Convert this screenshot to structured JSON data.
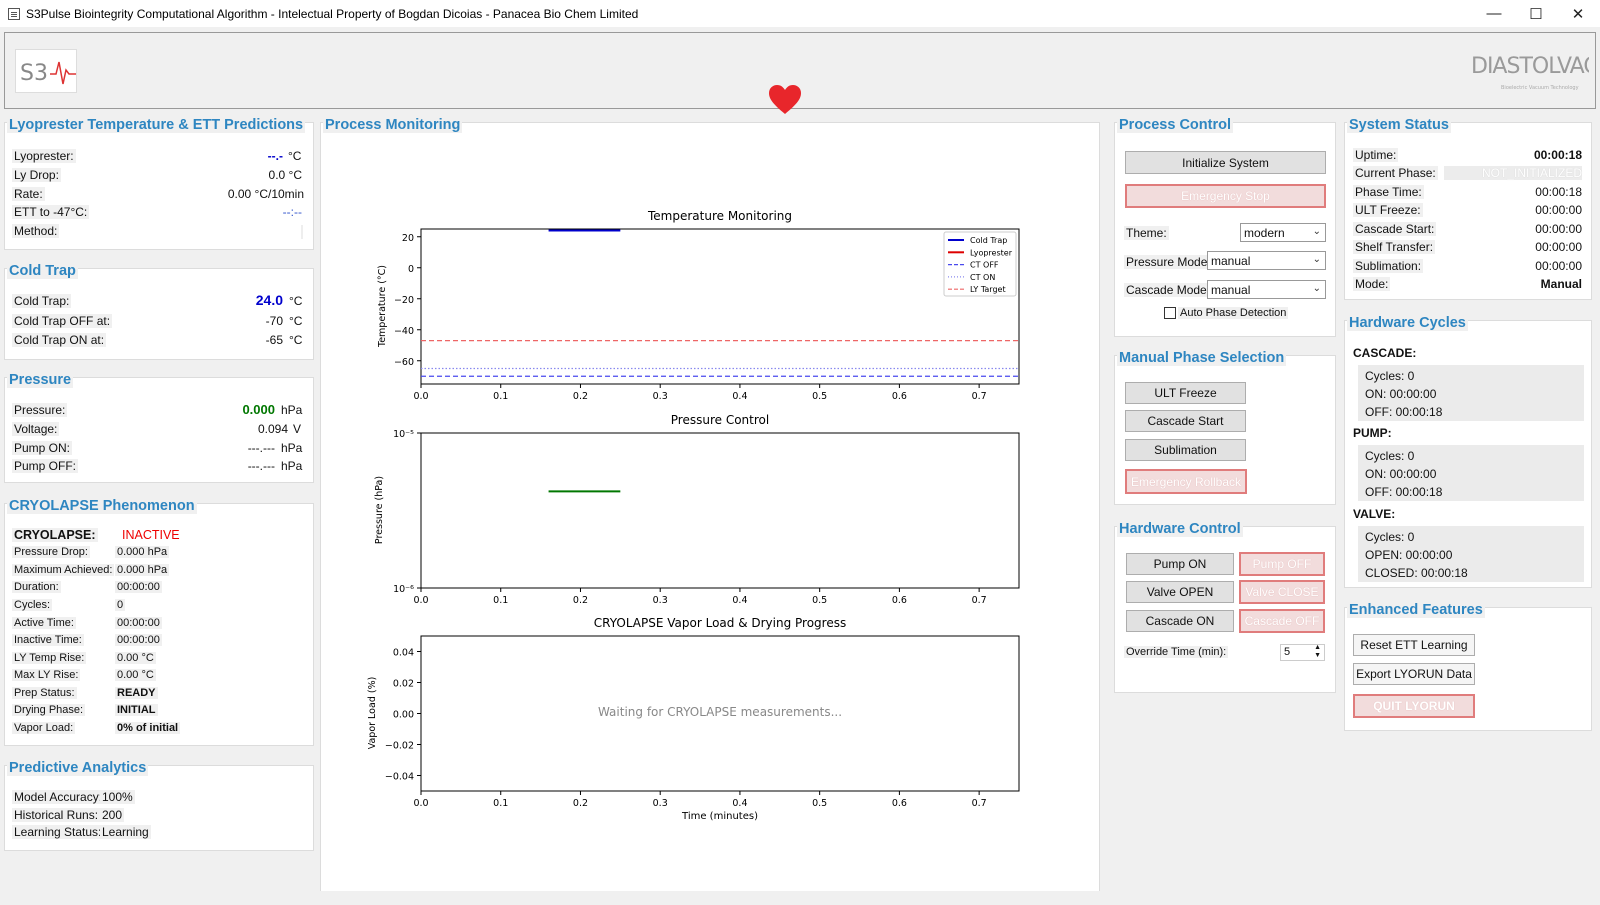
{
  "window": {
    "title": "S3Pulse Biointegrity Computational Algorithm - Intelectual Property of Bogdan Dicoias - Panacea Bio Chem Limited",
    "min": "—",
    "max": "☐",
    "close": "✕"
  },
  "branding": {
    "left_logo": "S3",
    "right_logo": "DIASTOLVAC",
    "right_logo_tag": "Bioelectric Vacuum Technology"
  },
  "lyo": {
    "title": "Lyoprester Temperature & ETT Predictions",
    "rows": [
      {
        "label": "Lyoprester:",
        "value": "--.-",
        "unit": "°C"
      },
      {
        "label": "Ly Drop:",
        "value": "0.0 °C",
        "unit": ""
      },
      {
        "label": "Rate:",
        "value": "0.00 °C/10min",
        "unit": ""
      },
      {
        "label": "ETT to -47°C:",
        "value": "--:--",
        "unit": ""
      },
      {
        "label": "Method:",
        "value": "",
        "unit": ""
      }
    ]
  },
  "cold": {
    "title": "Cold Trap",
    "rows": [
      {
        "label": "Cold Trap:",
        "value": "24.0",
        "unit": "°C"
      },
      {
        "label": "Cold Trap OFF at:",
        "value": "-70",
        "unit": "°C"
      },
      {
        "label": "Cold Trap ON at:",
        "value": "-65",
        "unit": "°C"
      }
    ]
  },
  "pressure": {
    "title": "Pressure",
    "rows": [
      {
        "label": "Pressure:",
        "value": "0.000",
        "unit": "hPa"
      },
      {
        "label": "Voltage:",
        "value": "0.094",
        "unit": "V"
      },
      {
        "label": "Pump ON:",
        "value": "---.---",
        "unit": "hPa"
      },
      {
        "label": "Pump OFF:",
        "value": "---.---",
        "unit": "hPa"
      }
    ]
  },
  "cryo": {
    "title": "CRYOLAPSE Phenomenon",
    "rows": [
      {
        "label": "CRYOLAPSE:",
        "value": "INACTIVE"
      },
      {
        "label": "Pressure Drop:",
        "value": "0.000  hPa"
      },
      {
        "label": "Maximum Achieved:",
        "value": "0.000  hPa"
      },
      {
        "label": "Duration:",
        "value": "00:00:00"
      },
      {
        "label": "Cycles:",
        "value": "0"
      },
      {
        "label": "Active Time:",
        "value": "00:00:00"
      },
      {
        "label": "Inactive Time:",
        "value": "00:00:00"
      },
      {
        "label": "LY Temp Rise:",
        "value": "0.00  °C"
      },
      {
        "label": "Max LY Rise:",
        "value": "0.00  °C"
      },
      {
        "label": "Prep Status:",
        "value": "READY"
      },
      {
        "label": "Drying Phase:",
        "value": "INITIAL"
      },
      {
        "label": "Vapor Load:",
        "value": "0% of initial"
      }
    ]
  },
  "pred": {
    "title": "Predictive Analytics",
    "rows": [
      {
        "label": "Model Accuracy:",
        "value": "100%"
      },
      {
        "label": "Historical Runs:",
        "value": "200"
      },
      {
        "label": "Learning Status:",
        "value": "Learning"
      }
    ]
  },
  "monitor": {
    "title": "Process Monitoring"
  },
  "chart_data": [
    {
      "type": "line",
      "title": "Temperature Monitoring",
      "xlabel": "",
      "ylabel": "Temperature (°C)",
      "xlim": [
        0,
        0.75
      ],
      "ylim": [
        -75,
        25
      ],
      "xticks": [
        "0.0",
        "0.1",
        "0.2",
        "0.3",
        "0.4",
        "0.5",
        "0.6",
        "0.7"
      ],
      "yticks": [
        "20",
        "0",
        "−20",
        "−40",
        "−60"
      ],
      "ytick_values": [
        20,
        0,
        -20,
        -40,
        -60
      ],
      "legend": "top-right",
      "series": [
        {
          "name": "Cold Trap",
          "color": "#0000cc",
          "style": "solid",
          "x": [
            0.16,
            0.25
          ],
          "y": [
            24,
            24
          ]
        },
        {
          "name": "Lyoprester",
          "color": "#dd0000",
          "style": "solid",
          "x": [],
          "y": []
        },
        {
          "name": "CT OFF",
          "color": "#4a4aee",
          "style": "dashed",
          "x": [
            0,
            0.75
          ],
          "y": [
            -70,
            -70
          ]
        },
        {
          "name": "CT ON",
          "color": "#8888ee",
          "style": "dotted",
          "x": [
            0,
            0.75
          ],
          "y": [
            -65,
            -65
          ]
        },
        {
          "name": "LY Target",
          "color": "#ee6666",
          "style": "dashed",
          "x": [
            0,
            0.75
          ],
          "y": [
            -47,
            -47
          ]
        }
      ]
    },
    {
      "type": "line",
      "title": "Pressure Control",
      "xlabel": "",
      "ylabel": "Pressure (hPa)",
      "xlim": [
        0,
        0.75
      ],
      "ylim": [
        1e-06,
        1e-05
      ],
      "yscale": "log",
      "xticks": [
        "0.0",
        "0.1",
        "0.2",
        "0.3",
        "0.4",
        "0.5",
        "0.6",
        "0.7"
      ],
      "yticks": [
        "10⁻⁵",
        "10⁻⁶"
      ],
      "series": [
        {
          "name": "",
          "color": "#007700",
          "style": "solid",
          "x": [
            0.16,
            0.25
          ],
          "y": [
            4.2e-06,
            4.2e-06
          ]
        }
      ]
    },
    {
      "type": "line",
      "title": "CRYOLAPSE Vapor Load & Drying Progress",
      "xlabel": "Time (minutes)",
      "ylabel": "Vapor Load (%)",
      "xlim": [
        0,
        0.75
      ],
      "ylim": [
        -0.05,
        0.05
      ],
      "xticks": [
        "0.0",
        "0.1",
        "0.2",
        "0.3",
        "0.4",
        "0.5",
        "0.6",
        "0.7"
      ],
      "yticks": [
        "0.04",
        "0.02",
        "0.00",
        "−0.02",
        "−0.04"
      ],
      "ytick_values": [
        0.04,
        0.02,
        0,
        -0.02,
        -0.04
      ],
      "annotation": "Waiting for CRYOLAPSE measurements...",
      "series": []
    }
  ],
  "control": {
    "title": "Process Control",
    "init": "Initialize System",
    "estop": "Emergency Stop",
    "theme_label": "Theme:",
    "theme": "modern",
    "pmode_label": "Pressure Mode:",
    "pmode": "manual",
    "cmode_label": "Cascade Mode:",
    "cmode": "manual",
    "auto": "Auto Phase Detection"
  },
  "manual": {
    "title": "Manual Phase Selection",
    "ult": "ULT Freeze",
    "cascade": "Cascade Start",
    "sub": "Sublimation",
    "rollback": "Emergency Rollback"
  },
  "hardware": {
    "title": "Hardware Control",
    "pump_on": "Pump ON",
    "pump_off": "Pump OFF",
    "valve_open": "Valve OPEN",
    "valve_close": "Valve CLOSE",
    "cascade_on": "Cascade ON",
    "cascade_off": "Cascade OFF",
    "override_label": "Override Time (min):",
    "override": "5"
  },
  "status": {
    "title": "System Status",
    "rows": [
      {
        "label": "Uptime:",
        "value": "00:00:18"
      },
      {
        "label": "Current Phase:",
        "value": "NOT_INITIALIZED"
      },
      {
        "label": "Phase Time:",
        "value": "00:00:18"
      },
      {
        "label": "ULT Freeze:",
        "value": "00:00:00"
      },
      {
        "label": "Cascade Start:",
        "value": "00:00:00"
      },
      {
        "label": "Shelf Transfer:",
        "value": "00:00:00"
      },
      {
        "label": "Sublimation:",
        "value": "00:00:00"
      },
      {
        "label": "Mode:",
        "value": "Manual"
      }
    ]
  },
  "cycles": {
    "title": "Hardware Cycles",
    "cascade": {
      "head": "CASCADE:",
      "l1": "Cycles:  0",
      "l2": "ON:  00:00:00",
      "l3": "OFF:  00:00:18"
    },
    "pump": {
      "head": "PUMP:",
      "l1": "Cycles:  0",
      "l2": "ON:  00:00:00",
      "l3": "OFF:  00:00:18"
    },
    "valve": {
      "head": "VALVE:",
      "l1": "Cycles:  0",
      "l2": "OPEN:  00:00:00",
      "l3": "CLOSED:  00:00:18"
    }
  },
  "enhanced": {
    "title": "Enhanced Features",
    "reset": "Reset ETT Learning",
    "export": "Export LYORUN Data",
    "quit": "QUIT LYORUN"
  }
}
